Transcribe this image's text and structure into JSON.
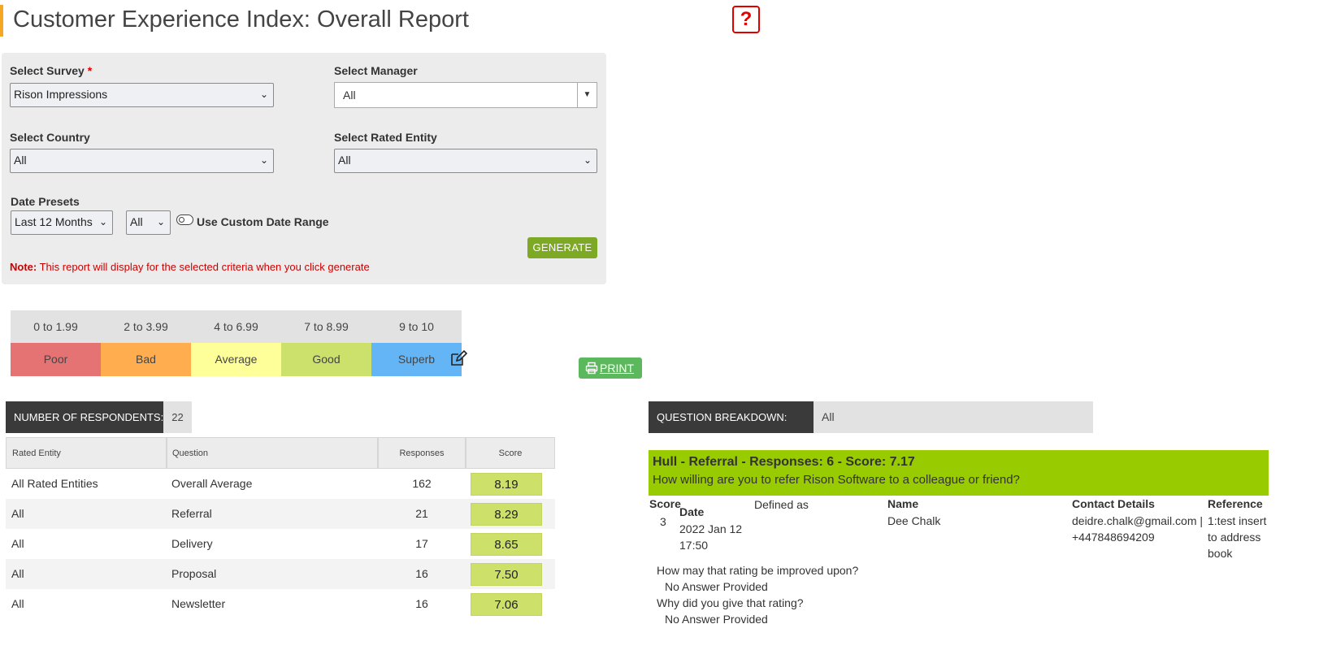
{
  "page": {
    "title": "Customer Experience Index: Overall Report",
    "help_symbol": "?"
  },
  "filters": {
    "survey": {
      "label": "Select Survey",
      "required_mark": "*",
      "value": "Rison Impressions"
    },
    "manager": {
      "label": "Select Manager",
      "value": "All"
    },
    "country": {
      "label": "Select Country",
      "value": "All"
    },
    "rated_entity": {
      "label": "Select Rated Entity",
      "value": "All"
    },
    "date_presets": {
      "label": "Date Presets",
      "value": "Last 12 Months",
      "secondary_value": "All"
    },
    "custom_range": {
      "label": "Use Custom Date Range",
      "enabled": false
    },
    "generate_label": "GENERATE",
    "note_prefix": "Note:",
    "note_text": "This report will display for the selected criteria when you click generate"
  },
  "legend": [
    {
      "range": "0 to 1.99",
      "label": "Poor",
      "color": "#e57373"
    },
    {
      "range": "2 to 3.99",
      "label": "Bad",
      "color": "#ffad4e"
    },
    {
      "range": "4 to 6.99",
      "label": "Average",
      "color": "#ffff99"
    },
    {
      "range": "7 to 8.99",
      "label": "Good",
      "color": "#cce06c"
    },
    {
      "range": "9 to 10",
      "label": "Superb",
      "color": "#64b5f6"
    }
  ],
  "print_label": "PRINT",
  "respondents": {
    "label": "NUMBER OF RESPONDENTS:",
    "count": "22"
  },
  "table": {
    "headers": [
      "Rated Entity",
      "Question",
      "Responses",
      "Score"
    ],
    "rows": [
      {
        "entity": "All Rated Entities",
        "question": "Overall Average",
        "responses": "162",
        "score": "8.19"
      },
      {
        "entity": "All",
        "question": "Referral",
        "responses": "21",
        "score": "8.29"
      },
      {
        "entity": "All",
        "question": "Delivery",
        "responses": "17",
        "score": "8.65"
      },
      {
        "entity": "All",
        "question": "Proposal",
        "responses": "16",
        "score": "7.50"
      },
      {
        "entity": "All",
        "question": "Newsletter",
        "responses": "16",
        "score": "7.06"
      }
    ]
  },
  "breakdown": {
    "label": "QUESTION BREAKDOWN:",
    "value": "All",
    "title": "Hull - Referral - Responses: 6 - Score: 7.17",
    "question": "How willing are you to refer Rison Software to a colleague or friend?",
    "columns": {
      "score": "Score",
      "date": "Date",
      "defined": "Defined as",
      "name": "Name",
      "contact": "Contact Details",
      "reference": "Reference"
    },
    "response": {
      "score": "3",
      "date_line1": "2022 Jan 12",
      "date_line2": "17:50",
      "name": "Dee Chalk",
      "contact_line1": "deidre.chalk@gmail.com |",
      "contact_line2": "+447848694209",
      "reference_line1": "1:test insert",
      "reference_line2": "to address",
      "reference_line3": "book"
    },
    "followups": [
      {
        "question": "How may that rating be improved upon?",
        "answer": "No Answer Provided"
      },
      {
        "question": "Why did you give that rating?",
        "answer": "No Answer Provided"
      }
    ]
  }
}
